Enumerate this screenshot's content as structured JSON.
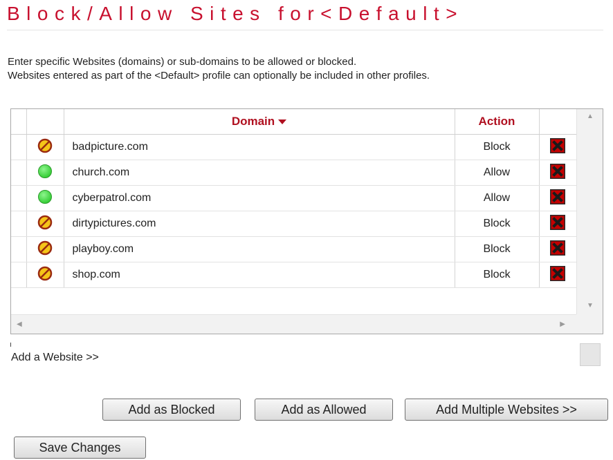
{
  "page": {
    "title": "Block/Allow Sites for<Default>",
    "description_line1": "Enter specific Websites (domains) or sub-domains to be allowed or blocked.",
    "description_line2": "Websites entered as part of the <Default> profile can optionally be included in other profiles."
  },
  "table": {
    "columns": {
      "domain": "Domain",
      "action": "Action"
    },
    "sort": {
      "column": "Domain",
      "direction": "descending-indicator"
    },
    "rows": [
      {
        "status": "blocked",
        "icon": "blocked-icon",
        "domain": "badpicture.com",
        "action": "Block"
      },
      {
        "status": "allowed",
        "icon": "allowed-icon",
        "domain": "church.com",
        "action": "Allow"
      },
      {
        "status": "allowed",
        "icon": "allowed-icon",
        "domain": "cyberpatrol.com",
        "action": "Allow"
      },
      {
        "status": "blocked",
        "icon": "blocked-icon",
        "domain": "dirtypictures.com",
        "action": "Block"
      },
      {
        "status": "blocked",
        "icon": "blocked-icon",
        "domain": "playboy.com",
        "action": "Block"
      },
      {
        "status": "blocked",
        "icon": "blocked-icon",
        "domain": "shop.com",
        "action": "Block"
      }
    ],
    "delete_icon": "delete-x-icon"
  },
  "add_website": {
    "label": "Add a Website >>"
  },
  "buttons": {
    "add_blocked": "Add as Blocked",
    "add_allowed": "Add as Allowed",
    "add_multiple": "Add Multiple Websites >>",
    "save": "Save Changes"
  },
  "colors": {
    "title": "#c8102e",
    "header_text": "#b01020",
    "blocked_fill": "#f5c518",
    "blocked_stroke": "#9a2a10",
    "allowed_fill": "#33cc33",
    "delete_bg": "#c40000"
  }
}
